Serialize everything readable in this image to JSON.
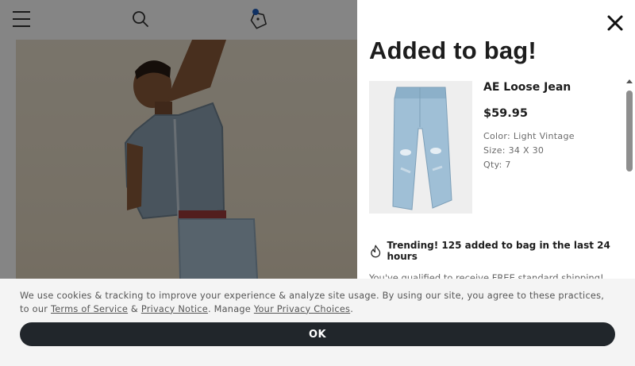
{
  "header": {
    "menu_icon": "hamburger-menu-icon",
    "search_icon": "search-icon",
    "tag_icon": "price-tag-icon"
  },
  "drawer": {
    "title": "Added to bag!",
    "close_icon": "close-icon",
    "product": {
      "name": "AE Loose Jean",
      "price": "$59.95",
      "color": "Color: Light Vintage",
      "size": "Size: 34 X 30",
      "qty": "Qty: 7"
    },
    "trending": {
      "icon": "flame-icon",
      "text": "Trending! 125 added to bag in the last 24 hours"
    },
    "shipping_message": "You've qualified to receive FREE standard shipping!"
  },
  "cookie_banner": {
    "text_before": "We use cookies & tracking to improve your experience & analyze site usage. By using our site, you agree to these practices, to our ",
    "terms_link": "Terms of Service",
    "ampersand": " & ",
    "privacy_link": "Privacy Notice",
    "manage_text": ". Manage ",
    "choices_link": "Your Privacy Choices",
    "end": ".",
    "ok_label": "OK"
  },
  "colors": {
    "accent_dot": "#1f5fbf",
    "button_dark": "#21262b",
    "overlay": "rgba(0,0,0,0.48)"
  }
}
